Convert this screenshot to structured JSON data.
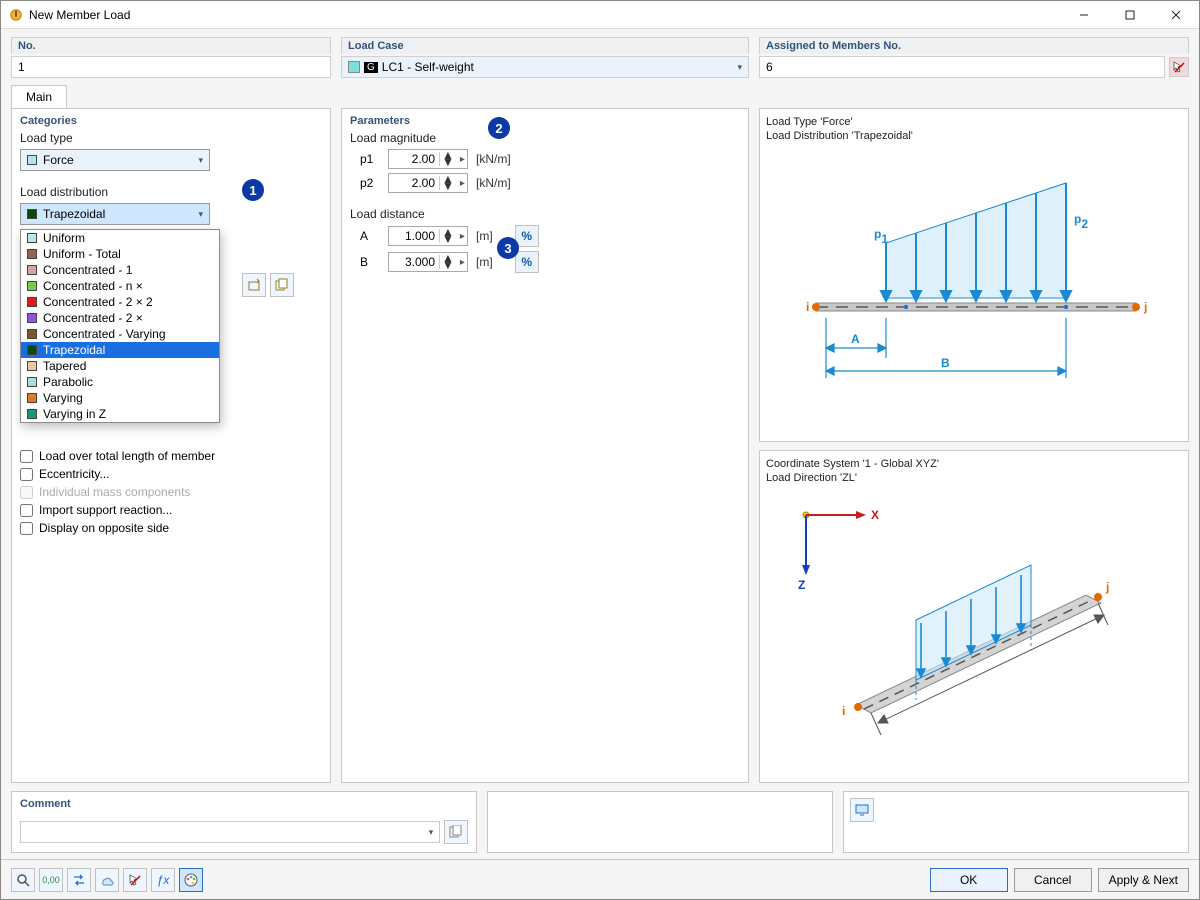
{
  "window": {
    "title": "New Member Load"
  },
  "top": {
    "no_label": "No.",
    "no_value": "1",
    "lc_label": "Load Case",
    "lc_value": "LC1 - Self-weight",
    "lc_badge": "G",
    "assign_label": "Assigned to Members No.",
    "assign_value": "6"
  },
  "tabs": {
    "main": "Main"
  },
  "categories": {
    "title": "Categories",
    "load_type_label": "Load type",
    "load_type_value": "Force",
    "load_dist_label": "Load distribution",
    "load_dist_value": "Trapezoidal",
    "options": [
      {
        "label": "Uniform",
        "color": "#b2e8ea"
      },
      {
        "label": "Uniform - Total",
        "color": "#8d6a4f"
      },
      {
        "label": "Concentrated - 1",
        "color": "#cfa8a3"
      },
      {
        "label": "Concentrated - n ×",
        "color": "#6fd14a"
      },
      {
        "label": "Concentrated - 2 × 2",
        "color": "#e11919"
      },
      {
        "label": "Concentrated - 2 ×",
        "color": "#8a54e0"
      },
      {
        "label": "Concentrated - Varying",
        "color": "#7a5a2a"
      },
      {
        "label": "Trapezoidal",
        "color": "#0a4a0a"
      },
      {
        "label": "Tapered",
        "color": "#e9c9a0"
      },
      {
        "label": "Parabolic",
        "color": "#a8ded8"
      },
      {
        "label": "Varying",
        "color": "#e07a2a"
      },
      {
        "label": "Varying in Z",
        "color": "#1a9a7a"
      }
    ],
    "selected_index": 7,
    "chk_total": "Load over total length of member",
    "chk_ecc": "Eccentricity...",
    "chk_mass": "Individual mass components",
    "chk_import": "Import support reaction...",
    "chk_display": "Display on opposite side"
  },
  "parameters": {
    "title": "Parameters",
    "magnitude_label": "Load magnitude",
    "p1_label": "p1",
    "p1_value": "2.00",
    "p1_unit": "[kN/m]",
    "p2_label": "p2",
    "p2_value": "2.00",
    "p2_unit": "[kN/m]",
    "distance_label": "Load distance",
    "A_label": "A",
    "A_value": "1.000",
    "A_unit": "[m]",
    "B_label": "B",
    "B_value": "3.000",
    "B_unit": "[m]",
    "pct": "%"
  },
  "preview": {
    "line1": "Load Type 'Force'",
    "line2": "Load Distribution 'Trapezoidal'",
    "p1": "p",
    "p1s": "1",
    "p2": "p",
    "p2s": "2",
    "A": "A",
    "B": "B",
    "i": "i",
    "j": "j",
    "cs1": "Coordinate System '1 - Global XYZ'",
    "cs2": "Load Direction 'ZL'",
    "X": "X",
    "Z": "Z"
  },
  "comment": {
    "label": "Comment"
  },
  "footer": {
    "ok": "OK",
    "cancel": "Cancel",
    "apply": "Apply & Next"
  },
  "badges": {
    "b1": "1",
    "b2": "2",
    "b3": "3"
  }
}
